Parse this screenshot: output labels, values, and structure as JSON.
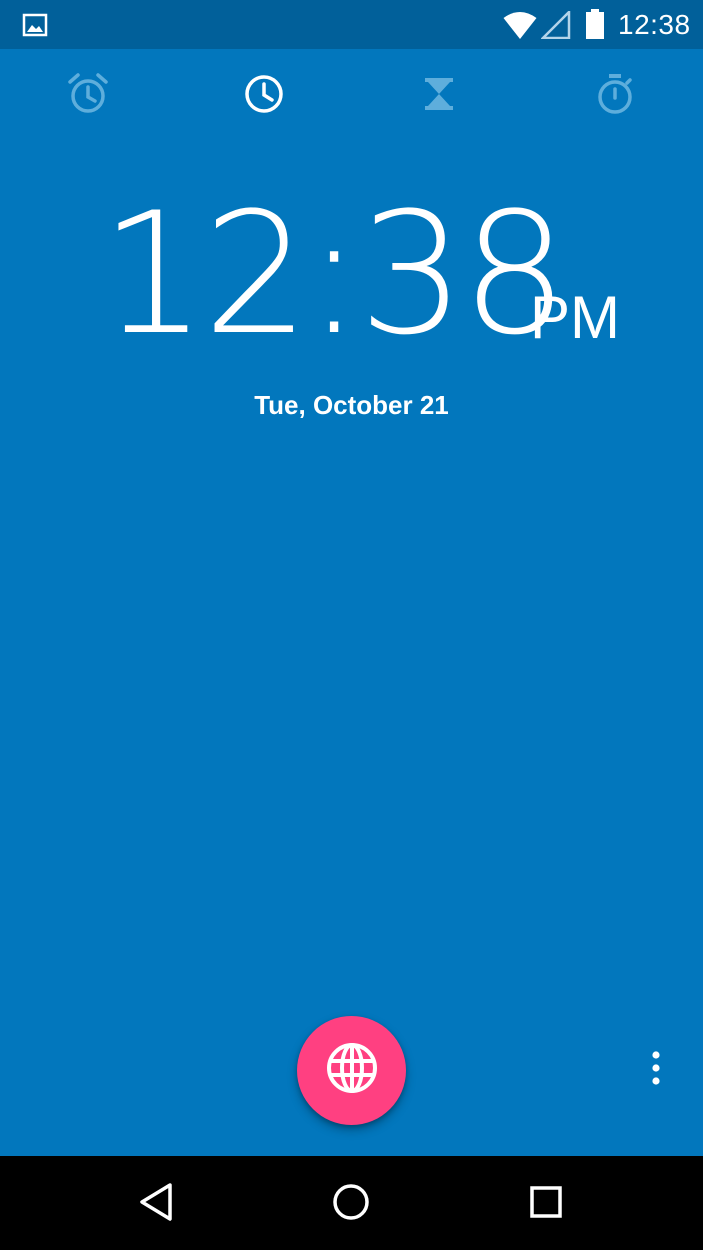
{
  "status_bar": {
    "time": "12:38",
    "icons": [
      "image-notification-icon",
      "wifi-icon",
      "cell-signal-icon",
      "battery-icon"
    ]
  },
  "tabs": [
    {
      "name": "alarm-icon",
      "selected": false
    },
    {
      "name": "clock-icon",
      "selected": true
    },
    {
      "name": "timer-icon",
      "selected": false
    },
    {
      "name": "stopwatch-icon",
      "selected": false
    }
  ],
  "clock": {
    "time": "12:38",
    "ampm": "PM",
    "date": "Tue, October 21"
  },
  "fab": {
    "icon": "globe-icon"
  },
  "overflow": {
    "icon": "more-vert-icon"
  },
  "nav_bar": {
    "icons": [
      "back-icon",
      "home-icon",
      "recents-icon"
    ]
  },
  "colors": {
    "background": "#0277bd",
    "status_bar": "#01609a",
    "fab": "#ff4081",
    "nav_bar": "#000000",
    "tab_inactive": "#5eaedc",
    "tab_active": "#ffffff"
  }
}
